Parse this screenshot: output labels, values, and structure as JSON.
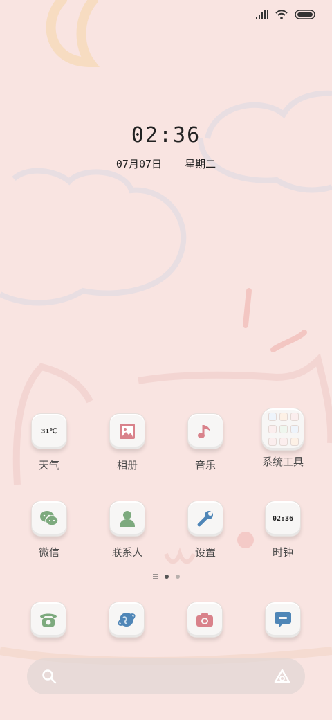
{
  "clock": {
    "time": "02:36"
  },
  "date": {
    "month_day": "07月07日",
    "weekday": "星期二"
  },
  "apps_row1": [
    {
      "label": "天气",
      "tile_text": "31℃",
      "icon": "weather-icon"
    },
    {
      "label": "相册",
      "icon": "gallery-icon"
    },
    {
      "label": "音乐",
      "icon": "music-icon"
    },
    {
      "label": "系统工具",
      "icon": "folder-icon"
    }
  ],
  "apps_row2": [
    {
      "label": "微信",
      "icon": "wechat-icon"
    },
    {
      "label": "联系人",
      "icon": "contacts-icon"
    },
    {
      "label": "设置",
      "icon": "settings-icon"
    },
    {
      "label": "时钟",
      "tile_text": "02:36",
      "icon": "clock-icon"
    }
  ],
  "dock": [
    {
      "icon": "phone-icon"
    },
    {
      "icon": "browser-icon"
    },
    {
      "icon": "camera-icon"
    },
    {
      "icon": "messages-icon"
    }
  ],
  "pager": {
    "pages": 2,
    "active": 1
  },
  "colors": {
    "background": "#f9e4e1",
    "pink_icon": "#d9828b",
    "green_icon": "#7daa7e",
    "blue_icon": "#4f86b7"
  }
}
